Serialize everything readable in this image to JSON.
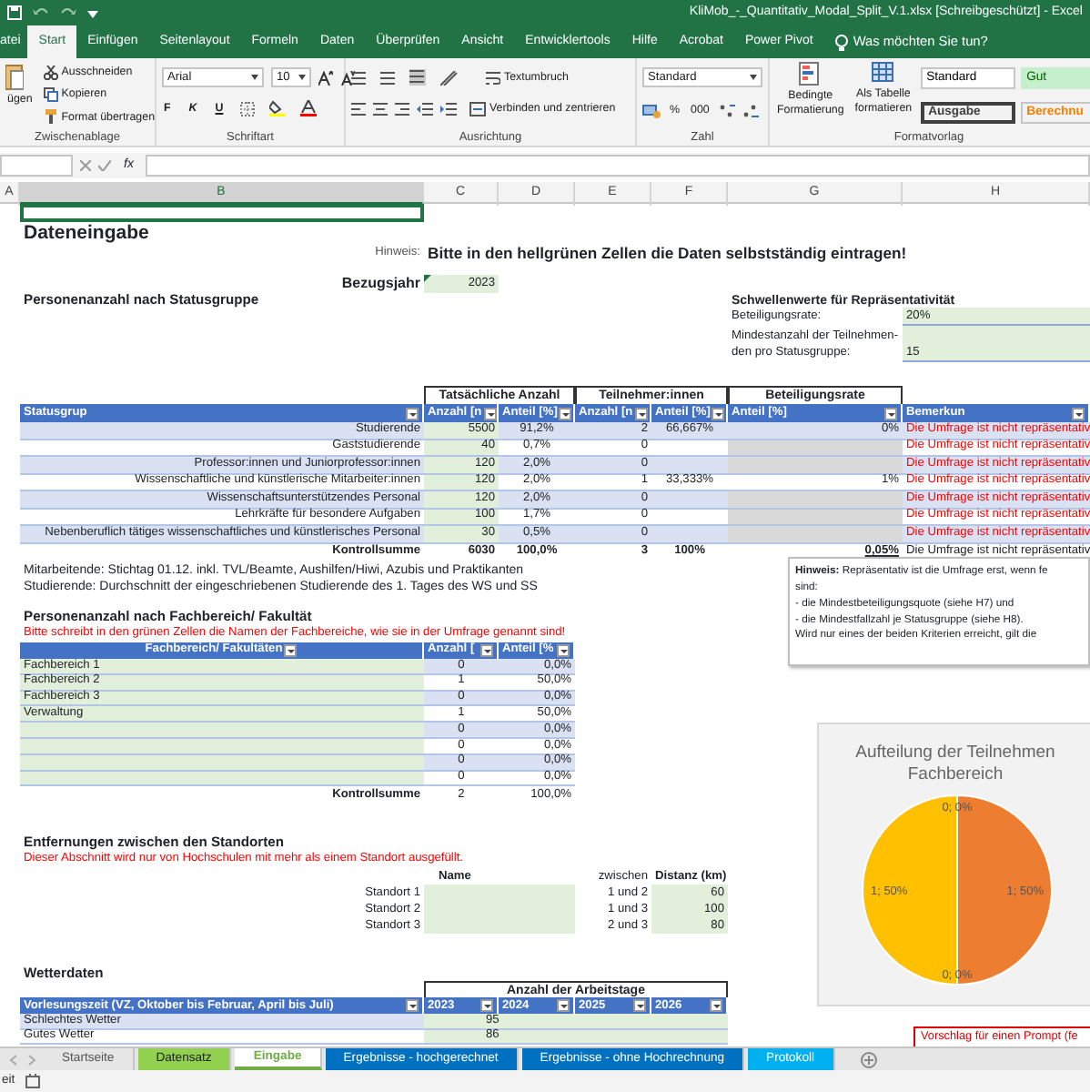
{
  "title_bar": {
    "title": "KliMob_-_Quantitativ_Modal_Split_V.1.xlsx  [Schreibgeschützt]  -  Excel"
  },
  "menu_tabs": [
    {
      "label": "atei",
      "selected": false
    },
    {
      "label": "Start",
      "selected": true
    },
    {
      "label": "Einfügen",
      "selected": false
    },
    {
      "label": "Seitenlayout",
      "selected": false
    },
    {
      "label": "Formeln",
      "selected": false
    },
    {
      "label": "Daten",
      "selected": false
    },
    {
      "label": "Überprüfen",
      "selected": false
    },
    {
      "label": "Ansicht",
      "selected": false
    },
    {
      "label": "Entwicklertools",
      "selected": false
    },
    {
      "label": "Hilfe",
      "selected": false
    },
    {
      "label": "Acrobat",
      "selected": false
    },
    {
      "label": "Power Pivot",
      "selected": false
    }
  ],
  "tell_me": "Was möchten Sie tun?",
  "ribbon": {
    "clipboard": {
      "paste": "ügen",
      "cut": "Ausschneiden",
      "copy": "Kopieren",
      "format_painter": "Format übertragen",
      "label": "Zwischenablage"
    },
    "font": {
      "name": "Arial",
      "size": "10",
      "bold": "F",
      "italic": "K",
      "underline": "U",
      "label": "Schriftart"
    },
    "alignment": {
      "wrap": "Textumbruch",
      "merge": "Verbinden und zentrieren",
      "label": "Ausrichtung"
    },
    "number": {
      "format": "Standard",
      "percent": "%",
      "thousands": "000",
      "label": "Zahl"
    },
    "styles": {
      "conditional": "Bedingte\nFormatierung",
      "as_table": "Als Tabelle\nformatieren",
      "label": "Formatvorlag",
      "cell_styles": [
        {
          "name": "Standard",
          "kind": "normal"
        },
        {
          "name": "Gut",
          "kind": "good"
        },
        {
          "name": "Ausgabe",
          "kind": "output"
        },
        {
          "name": "Berechnu",
          "kind": "calc"
        }
      ]
    }
  },
  "formula_bar": {
    "function_label": "fx"
  },
  "columns": [
    {
      "label": "A",
      "selected": false
    },
    {
      "label": "B",
      "selected": true
    },
    {
      "label": "C",
      "selected": false
    },
    {
      "label": "D",
      "selected": false
    },
    {
      "label": "E",
      "selected": false
    },
    {
      "label": "F",
      "selected": false
    },
    {
      "label": "G",
      "selected": false
    },
    {
      "label": "H",
      "selected": false
    }
  ],
  "sheet": {
    "heading": "Dateneingabe",
    "hint": {
      "label": "Hinweis:",
      "text": "Bitte in den hellgrünen Zellen die Daten selbstständig eintragen!"
    },
    "reference_year": {
      "label": "Bezugsjahr",
      "value": "2023"
    },
    "thresholds": {
      "title": "Schwellenwerte für Repräsentativität",
      "items": [
        {
          "label": "Beteiligungsrate:",
          "value": "20%"
        },
        {
          "label": "Mindestanzahl der Teilnehmen-\nden pro Statusgruppe:",
          "value": "15"
        }
      ]
    },
    "status_section": {
      "title": "Personenanzahl nach Statusgruppe",
      "group_headers": [
        "Tatsächliche Anzahl",
        "Teilnehmer:innen",
        "Beteiligungsrate"
      ],
      "columns": [
        "Statusgrup",
        "Anzahl [n",
        "Anteil [%]",
        "Anzahl [n",
        "Anteil [%]",
        "Anteil [%]",
        "Bemerkun"
      ],
      "rows": [
        {
          "label": "Studierende",
          "count": "5500",
          "share": "91,2%",
          "participants": "2",
          "participant_share": "66,667%",
          "rate": "0%",
          "greyed": false,
          "remark": "Die Umfrage ist nicht repräsentativ"
        },
        {
          "label": "Gaststudierende",
          "count": "40",
          "share": "0,7%",
          "participants": "0",
          "greyed": true,
          "remark": "Die Umfrage ist nicht repräsentativ"
        },
        {
          "label": "Professor:innen und Juniorprofessor:innen",
          "count": "120",
          "share": "2,0%",
          "participants": "0",
          "greyed": true,
          "remark": "Die Umfrage ist nicht repräsentativ"
        },
        {
          "label": "Wissenschaftliche und künstlerische Mitarbeiter:innen",
          "count": "120",
          "share": "2,0%",
          "participants": "1",
          "participant_share": "33,333%",
          "rate": "1%",
          "greyed": false,
          "remark": "Die Umfrage ist nicht repräsentativ"
        },
        {
          "label": "Wissenschaftsunterstützendes Personal",
          "count": "120",
          "share": "2,0%",
          "participants": "0",
          "greyed": true,
          "remark": "Die Umfrage ist nicht repräsentativ"
        },
        {
          "label": "Lehrkräfte für besondere Aufgaben",
          "count": "100",
          "share": "1,7%",
          "participants": "0",
          "greyed": true,
          "remark": "Die Umfrage ist nicht repräsentativ"
        },
        {
          "label": "Nebenberuflich tätiges wissenschaftliches und künstlerisches Personal",
          "count": "30",
          "share": "0,5%",
          "participants": "0",
          "greyed": true,
          "remark": "Die Umfrage ist nicht repräsentativ"
        }
      ],
      "total": {
        "label": "Kontrollsumme",
        "count": "6030",
        "share": "100,0%",
        "participants": "3",
        "participant_share": "100%",
        "rate": "0,05%",
        "remark": "Die Umfrage ist nicht repräsentativ"
      },
      "notes": [
        "Mitarbeitende: Stichtag 01.12. inkl. TVL/Beamte, Aushilfen/Hiwi, Azubis und Praktikanten",
        "Studierende: Durchschnitt der eingeschriebenen Studierende des 1. Tages des WS und SS"
      ]
    },
    "faculty_section": {
      "title": "Personenanzahl nach Fachbereich/ Fakultät",
      "warning": "Bitte schreibt in den grünen Zellen die Namen der Fachbereiche, wie sie in der Umfrage genannt sind!",
      "columns": [
        "Fachbereich/ Fakultäten",
        "Anzahl [",
        "Anteil [%"
      ],
      "rows": [
        {
          "name": "Fachbereich 1",
          "count": "0",
          "share": "0,0%"
        },
        {
          "name": "Fachbereich 2",
          "count": "1",
          "share": "50,0%"
        },
        {
          "name": "Fachbereich 3",
          "count": "0",
          "share": "0,0%"
        },
        {
          "name": "Verwaltung",
          "count": "1",
          "share": "50,0%"
        },
        {
          "count": "0",
          "share": "0,0%"
        },
        {
          "count": "0",
          "share": "0,0%"
        },
        {
          "count": "0",
          "share": "0,0%"
        },
        {
          "count": "0",
          "share": "0,0%"
        }
      ],
      "total": {
        "label": "Kontrollsumme",
        "count": "2",
        "share": "100,0%"
      }
    },
    "locations": {
      "title": "Entfernungen zwischen den Standorten",
      "warning": "Dieser Abschnitt wird nur von Hochschulen mit mehr als einem Standort ausgefüllt.",
      "name_header": "Name",
      "between_header": "zwischen",
      "distance_header": "Distanz (km)",
      "sites": [
        "Standort 1",
        "Standort 2",
        "Standort 3"
      ],
      "pairs": [
        {
          "pair": "1 und 2",
          "distance": "60"
        },
        {
          "pair": "1 und 3",
          "distance": "100"
        },
        {
          "pair": "2 und 3",
          "distance": "80"
        }
      ]
    },
    "weather": {
      "title": "Wetterdaten",
      "group_header": "Anzahl der Arbeitstage",
      "columns": [
        "Vorlesungszeit (VZ, Oktober bis Februar, April bis Juli)",
        "2023",
        "2024",
        "2025",
        "2026"
      ],
      "rows": [
        {
          "label": "Schlechtes Wetter",
          "value": "95"
        },
        {
          "label": "Gutes Wetter",
          "value": "86"
        }
      ]
    },
    "note_box": {
      "lines": [
        "**Hinweis:** Repräsentativ ist die Umfrage erst, wenn fe",
        "sind:",
        "- die Mindestbeteiligungsquote (siehe H7) und",
        "- die Mindestfallzahl je Statusgruppe (siehe H8).",
        "Wird nur eines der beiden Kriterien erreicht, gilt die"
      ]
    },
    "chart": {
      "chart_data": {
        "type": "pie",
        "title": "Aufteilung der Teilnehmen\nFachbereich",
        "values": [
          0,
          1,
          0,
          1
        ],
        "data_labels": true,
        "value_labels": [
          "0; 0%",
          "1; 50%",
          "0; 0%",
          "1; 50%"
        ]
      }
    },
    "prompt_box": {
      "text": "Vorschlag für einen Prompt (fe"
    }
  },
  "sheet_tabs": [
    {
      "label": "Startseite",
      "selected": false
    },
    {
      "label": "Datensatz",
      "selected": false,
      "color": "#92d050"
    },
    {
      "label": "Eingabe",
      "selected": true,
      "color": "#70ad47"
    },
    {
      "label": "Ergebnisse - hochgerechnet",
      "selected": false,
      "color": "#0070c0"
    },
    {
      "label": "Ergebnisse - ohne Hochrechnung",
      "selected": false,
      "color": "#0070c0"
    },
    {
      "label": "Protokoll",
      "selected": false,
      "color": "#00b0f0"
    }
  ],
  "status_bar": {
    "text": "eit"
  }
}
